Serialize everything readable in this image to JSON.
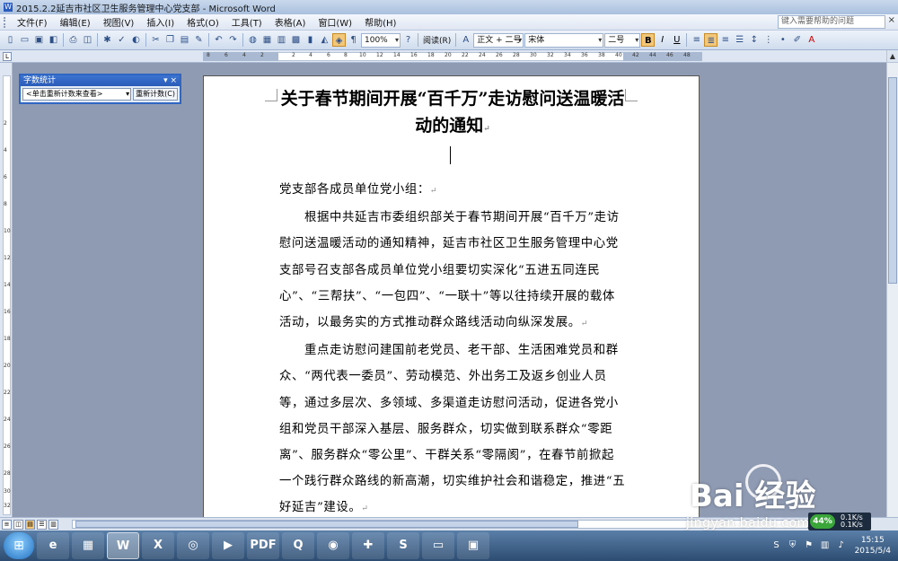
{
  "window": {
    "title": "2015.2.2延吉市社区卫生服务管理中心党支部 - Microsoft Word",
    "app_icon": "W"
  },
  "menu": {
    "items": [
      "文件(F)",
      "编辑(E)",
      "视图(V)",
      "插入(I)",
      "格式(O)",
      "工具(T)",
      "表格(A)",
      "窗口(W)",
      "帮助(H)"
    ],
    "help_placeholder": "键入需要帮助的问题",
    "close_glyph": "×"
  },
  "toolbar": {
    "zoom": "100%",
    "read_label": "阅读(R)",
    "style": "正文 + 二号",
    "font": "宋体",
    "size": "二号",
    "bold": "B",
    "italic": "I",
    "underline": "U"
  },
  "ruler": {
    "horizontal_ticks": [
      "8",
      "6",
      "4",
      "2",
      "2",
      "4",
      "6",
      "8",
      "10",
      "12",
      "14",
      "16",
      "18",
      "20",
      "22",
      "24",
      "26",
      "28",
      "30",
      "32",
      "34",
      "36",
      "38",
      "40",
      "42",
      "44",
      "46",
      "48"
    ],
    "vertical_ticks": [
      "2",
      "4",
      "6",
      "8",
      "10",
      "12",
      "14",
      "16",
      "18",
      "20",
      "22",
      "24",
      "26",
      "28",
      "30",
      "32"
    ]
  },
  "word_count_panel": {
    "title": "字数统计",
    "select_value": "<单击重新计数来查看>",
    "recount_button": "重新计数(C)",
    "title_buttons": "▾ ×"
  },
  "document": {
    "title": "关于春节期间开展“百千万”走访慰问送温暖活动的通知",
    "salutation": "党支部各成员单位党小组：",
    "paragraph_1": "根据中共延吉市委组织部关于春节期间开展“百千万”走访慰问送温暖活动的通知精神，延吉市社区卫生服务管理中心党支部号召支部各成员单位党小组要切实深化“五进五同连民心”、“三帮扶”、“一包四”、“一联十”等以往持续开展的载体活动，以最务实的方式推动群众路线活动向纵深发展。",
    "paragraph_2": "重点走访慰问建国前老党员、老干部、生活困难党员和群众、“两代表一委员”、劳动模范、外出务工及返乡创业人员等，通过多层次、多领域、多渠道走访慰问活动，促进各党小组和党员干部深入基层、服务群众，切实做到联系群众“零距离”、服务群众“零公里”、干群关系“零隔阂”，在春节前掀起一个践行群众路线的新高潮，切实维护社会和谐稳定，推进“五好延吉”建设。",
    "paragraph_mark": "↵"
  },
  "taskbar": {
    "start_glyph": "⊞",
    "apps": [
      {
        "name": "ie-icon",
        "glyph": "e"
      },
      {
        "name": "explorer-icon",
        "glyph": "▦"
      },
      {
        "name": "word-icon",
        "glyph": "W"
      },
      {
        "name": "excel-icon",
        "glyph": "X"
      },
      {
        "name": "chat-icon",
        "glyph": "◎"
      },
      {
        "name": "player-icon",
        "glyph": "▶"
      },
      {
        "name": "pdf-icon",
        "glyph": "PDF"
      },
      {
        "name": "qq-icon",
        "glyph": "Q"
      },
      {
        "name": "browser-icon",
        "glyph": "◉"
      },
      {
        "name": "antivirus-icon",
        "glyph": "✚"
      },
      {
        "name": "input-icon",
        "glyph": "S"
      },
      {
        "name": "folder-icon",
        "glyph": "▭"
      },
      {
        "name": "tool-icon",
        "glyph": "▣"
      }
    ],
    "network_percent": "44%",
    "upload_rate": "0.1K/s",
    "download_rate": "0.1K/s",
    "time": "15:15",
    "date": "2015/5/4",
    "tray_ime": "S"
  },
  "watermark": {
    "text": "Bai 经验",
    "url": "jingyan.baidu.com"
  },
  "colors": {
    "accent": "#2f66c4",
    "toolbar_active": "#f3c77a"
  }
}
